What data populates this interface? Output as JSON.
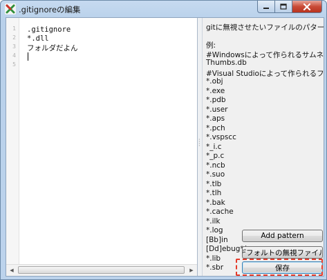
{
  "window": {
    "title": ".gitignoreの編集"
  },
  "editor": {
    "line_numbers": [
      "1",
      "2",
      "3",
      "4",
      "5"
    ],
    "lines": [
      ".gitignore",
      "*.dll",
      "フォルダだよん",
      ""
    ]
  },
  "help": {
    "lines": [
      "gitに無視させたいファイルのパターンを指定してください。",
      "",
      "例:",
      "#Windowsによって作られるサムネイルを無視",
      "Thumbs.db",
      "#Visual Studioによって作られるファイルを無視",
      "*.obj",
      "*.exe",
      "*.pdb",
      "*.user",
      "*.aps",
      "*.pch",
      "*.vspscc",
      "*_i.c",
      "*_p.c",
      "*.ncb",
      "*.suo",
      "*.tlb",
      "*.tlh",
      "*.bak",
      "*.cache",
      "*.ilk",
      "*.log",
      "[Bb]in",
      "[Dd]ebug*/",
      "*.lib",
      "*.sbr"
    ]
  },
  "buttons": {
    "add_pattern": "Add pattern",
    "default_ignore": "デフォルトの無視ファイル",
    "save": "保存"
  },
  "colors": {
    "highlight_border": "#e53a2a",
    "title_bar": "#c6daf0",
    "close_button": "#c94b37"
  }
}
